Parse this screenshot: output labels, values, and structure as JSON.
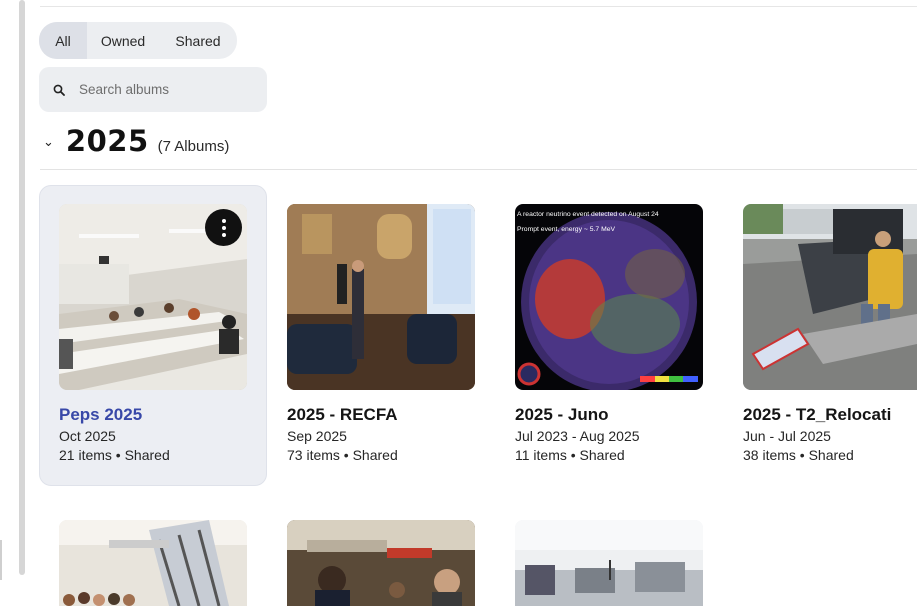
{
  "filters": {
    "all": "All",
    "owned": "Owned",
    "shared": "Shared",
    "selected": "All"
  },
  "search": {
    "placeholder": "Search albums"
  },
  "section": {
    "year": "2025",
    "count": "(7 Albums)"
  },
  "albums": [
    {
      "title": "Peps 2025",
      "date": "Oct 2025",
      "meta": "21 items  •  Shared"
    },
    {
      "title": "2025 - RECFA",
      "date": "Sep 2025",
      "meta": "73 items  •  Shared"
    },
    {
      "title": "2025 - Juno",
      "date": "Jul 2023 - Aug 2025",
      "meta": "11 items  •  Shared",
      "thumb_text_1": "A reactor neutrino event detected on August 24",
      "thumb_text_2": "Prompt event, energy ~ 5.7 MeV"
    },
    {
      "title": "2025 - T2_Relocati",
      "date": "Jun - Jul 2025",
      "meta": "38 items  •  Shared"
    }
  ],
  "colors": {
    "accent_title": "#3848a8",
    "chip_bg": "#eceef1",
    "chip_active": "#dde0e7"
  }
}
